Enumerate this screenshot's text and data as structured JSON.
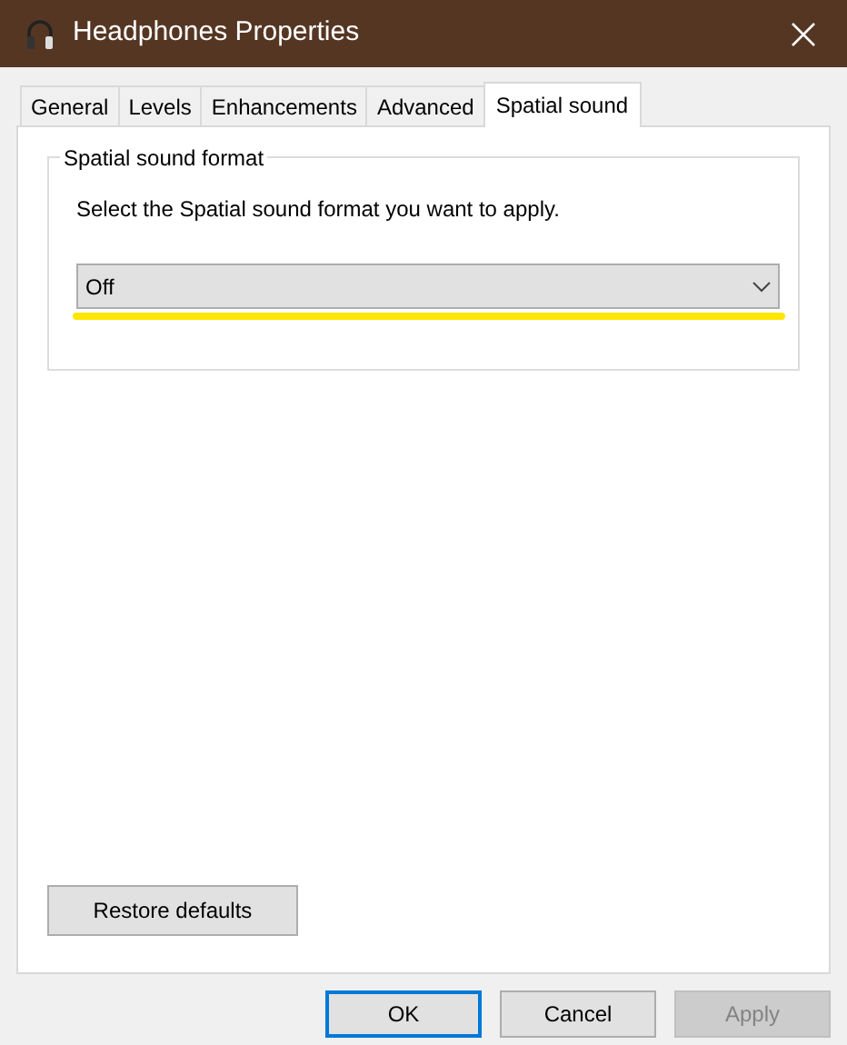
{
  "window": {
    "title": "Headphones Properties"
  },
  "tabs": [
    {
      "label": "General",
      "selected": false
    },
    {
      "label": "Levels",
      "selected": false
    },
    {
      "label": "Enhancements",
      "selected": false
    },
    {
      "label": "Advanced",
      "selected": false
    },
    {
      "label": "Spatial sound",
      "selected": true
    }
  ],
  "group": {
    "title": "Spatial sound format",
    "instruction": "Select the Spatial sound format you want to apply.",
    "dropdown": {
      "value": "Off",
      "highlighted": true
    }
  },
  "restore_button": "Restore defaults",
  "buttons": [
    {
      "label": "OK",
      "focused": true,
      "disabled": false
    },
    {
      "label": "Cancel",
      "focused": false,
      "disabled": false
    },
    {
      "label": "Apply",
      "focused": false,
      "disabled": true
    }
  ]
}
